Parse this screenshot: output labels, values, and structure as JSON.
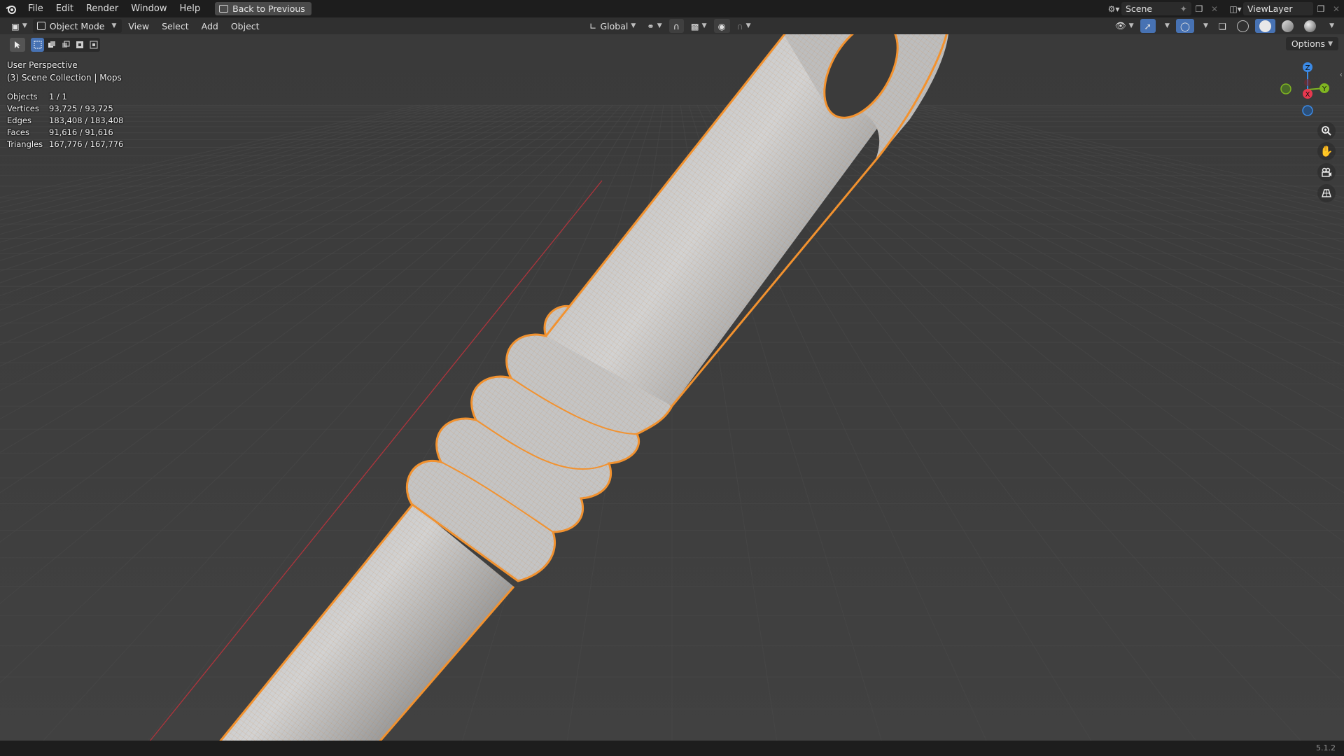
{
  "topbar": {
    "menus": [
      "File",
      "Edit",
      "Render",
      "Window",
      "Help"
    ],
    "back_label": "Back to Previous",
    "scene_name": "Scene",
    "view_layer": "ViewLayer"
  },
  "header": {
    "mode": "Object Mode",
    "menus": [
      "View",
      "Select",
      "Add",
      "Object"
    ],
    "transform_orientation": "Global",
    "options_label": "Options"
  },
  "overlay": {
    "view_name": "User Perspective",
    "collection": "(3) Scene Collection | Mops"
  },
  "stats": [
    {
      "label": "Objects",
      "value": "1 / 1"
    },
    {
      "label": "Vertices",
      "value": "93,725 / 93,725"
    },
    {
      "label": "Edges",
      "value": "183,408 / 183,408"
    },
    {
      "label": "Faces",
      "value": "91,616 / 91,616"
    },
    {
      "label": "Triangles",
      "value": "167,776 / 167,776"
    }
  ],
  "gizmo": {
    "z": "Z",
    "x": "X",
    "y": "Y"
  },
  "status": {
    "version": "5.1.2"
  },
  "colors": {
    "selection_outline": "#f2922f",
    "active_mode_blue": "#4772b3",
    "axis_x": "#e8384f",
    "axis_y": "#7fb521",
    "axis_z": "#3b8ae6",
    "viewport_bg": "#3d3d3d"
  },
  "icons": [
    "blender-logo-icon",
    "back-icon",
    "scene-icon",
    "pin-icon",
    "new-scene-icon",
    "viewlayer-icon",
    "editor-type-icon",
    "object-mode-icon",
    "orientation-icon",
    "pivot-icon",
    "snap-icon",
    "proportional-icon",
    "visibility-icon",
    "gizmo-icon",
    "overlay-icon",
    "xray-icon",
    "wireframe-shading-icon",
    "solid-shading-icon",
    "material-shading-icon",
    "rendered-shading-icon",
    "select-tool-icon",
    "zoom-icon",
    "pan-icon",
    "camera-icon",
    "ortho-toggle-icon"
  ]
}
